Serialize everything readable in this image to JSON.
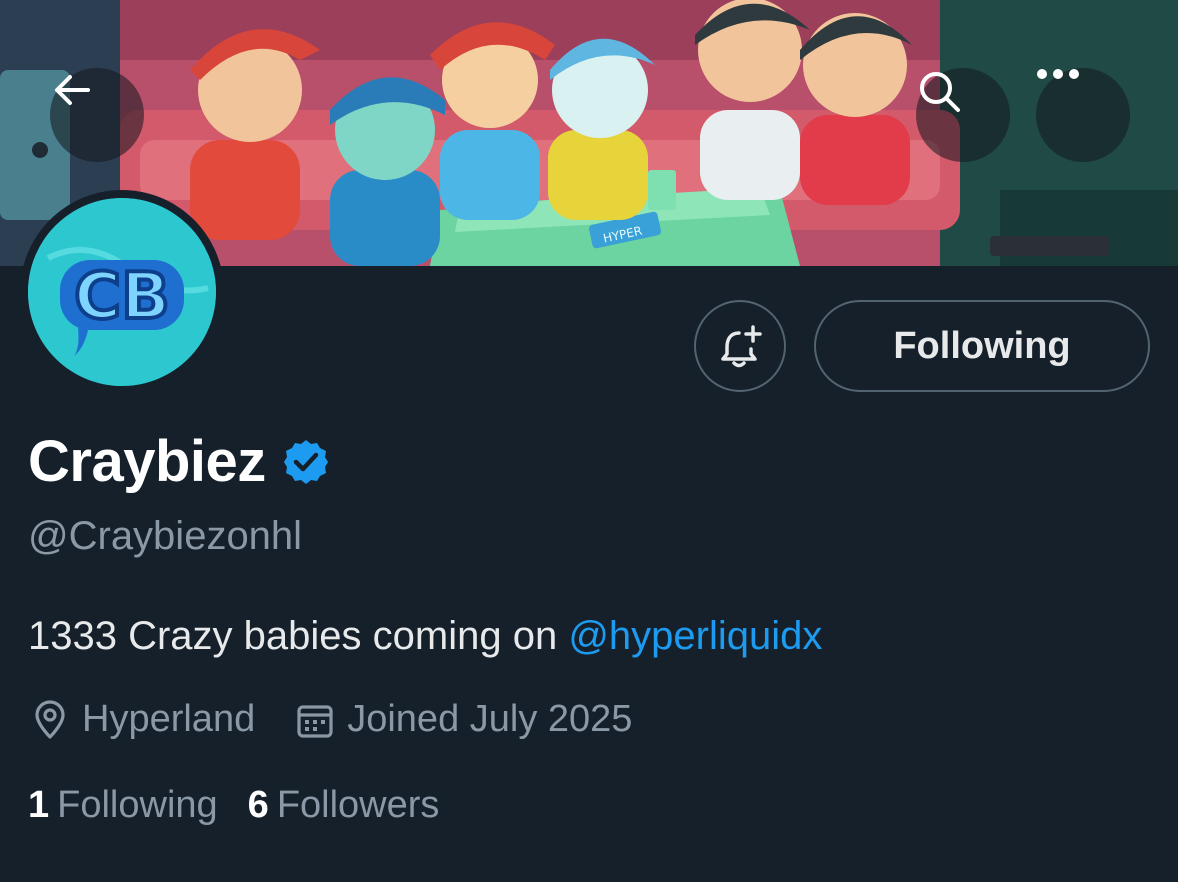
{
  "header": {
    "back_icon": "arrow-left-icon",
    "search_icon": "search-icon",
    "more_icon": "more-horizontal-icon"
  },
  "banner": {
    "sign_text": "HYPER"
  },
  "avatar": {
    "logo_text": "CB"
  },
  "actions": {
    "notify_icon": "bell-plus-icon",
    "following_label": "Following"
  },
  "profile": {
    "display_name": "Craybiez",
    "verified_icon": "verified-badge-icon",
    "handle": "@Craybiezonhl",
    "bio_text": "1333 Crazy babies coming on ",
    "bio_mention": "@hyperliquidx",
    "location": "Hyperland",
    "joined": "Joined July 2025"
  },
  "stats": {
    "following_count": "1",
    "following_label": "Following",
    "followers_count": "6",
    "followers_label": "Followers"
  },
  "colors": {
    "background": "#15202b",
    "accent": "#1d9bf0",
    "muted_text": "#8b98a5"
  }
}
